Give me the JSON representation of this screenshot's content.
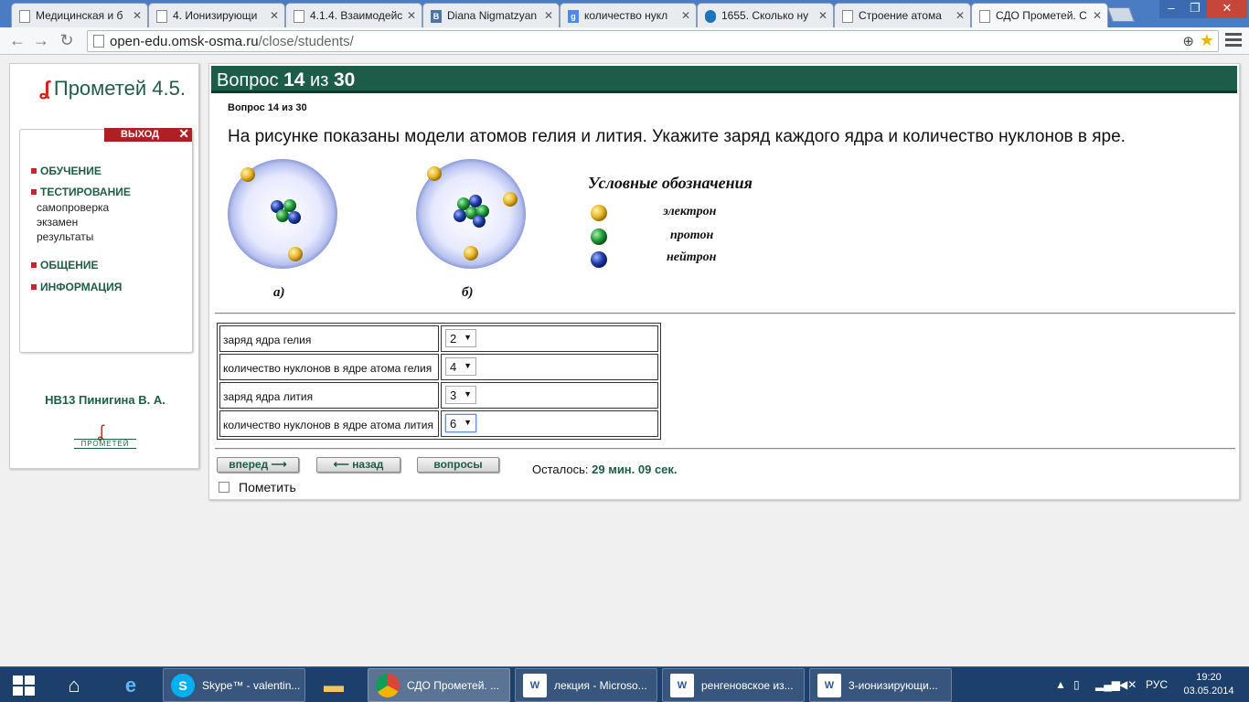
{
  "browser": {
    "tabs": [
      {
        "title": "Медицинская и б",
        "icon": "page-icon"
      },
      {
        "title": "4. Ионизирующи",
        "icon": "page-icon"
      },
      {
        "title": "4.1.4. Взаимодейс",
        "icon": "page-icon"
      },
      {
        "title": "Diana Nigmatzyan",
        "icon": "vk-icon",
        "glyph": "B"
      },
      {
        "title": "количество нукл",
        "icon": "google-icon",
        "glyph": "g"
      },
      {
        "title": "1655. Сколько ну",
        "icon": "drupal-icon",
        "glyph": ""
      },
      {
        "title": "Строение атома",
        "icon": "page-icon"
      },
      {
        "title": "СДО Прометей. С",
        "icon": "page-icon",
        "active": true
      }
    ],
    "url_host": "open-edu.omsk-osma.ru",
    "url_path": "/close/students/"
  },
  "sidebar": {
    "logo_text": "Прометей 4.5.",
    "exit_label": "ВЫХОД",
    "menu": [
      {
        "label": "ОБУЧЕНИЕ"
      },
      {
        "label": "ТЕСТИРОВАНИЕ"
      },
      {
        "label": "ОБЩЕНИЕ"
      },
      {
        "label": "ИНФОРМАЦИЯ"
      }
    ],
    "testing_submenu": [
      "самопроверка",
      "экзамен",
      "результаты"
    ],
    "user_name": "НВ13 Пинигина В. А.",
    "small_logo_text": "ПРОМЕТЕЙ"
  },
  "question": {
    "header_word": "Вопрос",
    "header_num": "14",
    "header_of": "из",
    "header_total": "30",
    "subheader": "Вопрос 14 из 30",
    "text": "На рисунке показаны модели атомов гелия и лития. Укажите заряд каждого ядра и количество нуклонов в яре.",
    "figure": {
      "label_a": "а)",
      "label_b": "б)",
      "legend_title": "Условные обозначения",
      "legend": [
        {
          "label": "электрон",
          "color": "#e8b628"
        },
        {
          "label": "протон",
          "color": "#1f9a3a"
        },
        {
          "label": "нейтрон",
          "color": "#1e3fa8"
        }
      ]
    },
    "answers": [
      {
        "label": "заряд ядра гелия",
        "value": "2"
      },
      {
        "label": "количество нуклонов в ядре атома гелия",
        "value": "4"
      },
      {
        "label": "заряд ядра лития",
        "value": "3"
      },
      {
        "label": "количество нуклонов в ядре атома лития",
        "value": "6",
        "focused": true
      }
    ],
    "buttons": {
      "forward": "вперед",
      "back": "назад",
      "questions": "вопросы"
    },
    "remaining_label": "Осталось:",
    "remaining_value": "29 мин. 09 сек.",
    "mark_label": "Пометить"
  },
  "taskbar": {
    "items": [
      {
        "label": "Skype™ - valentin...",
        "icon": "skype-icon",
        "glyph": "S"
      },
      {
        "label": "СДО Прометей. ...",
        "icon": "chrome-icon",
        "glyph": "",
        "active": true
      },
      {
        "label": "лекция - Microso...",
        "icon": "word-icon",
        "glyph": "W"
      },
      {
        "label": "ренгеновское из...",
        "icon": "word-icon",
        "glyph": "W"
      },
      {
        "label": "3-ионизирующи...",
        "icon": "word-icon",
        "glyph": "W"
      }
    ],
    "lang": "РУС",
    "time": "19:20",
    "date": "03.05.2014"
  },
  "colors": {
    "brand_green": "#1c5c48",
    "exit_red": "#b01f24",
    "taskbar_blue": "#1d3f6c"
  }
}
